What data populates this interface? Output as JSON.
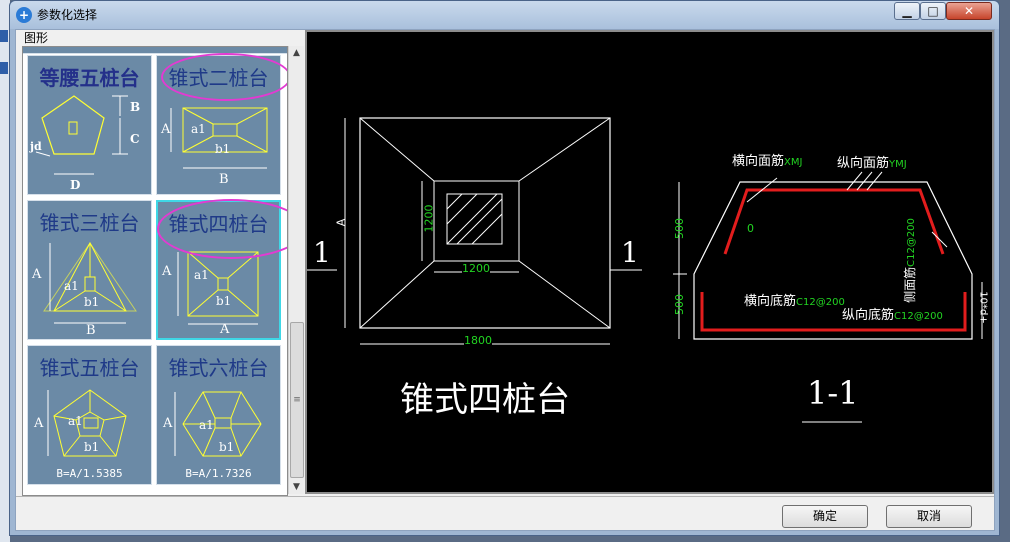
{
  "window": {
    "title": "参数化选择",
    "app_icon": "app-icon",
    "minimize": "▁",
    "maximize": "□",
    "close": "✕"
  },
  "group": {
    "label": "图形"
  },
  "tiles": [
    {
      "name": "等腰五桩台",
      "labels": {
        "b": "B",
        "c": "C",
        "d": "D",
        "jd": "jd"
      }
    },
    {
      "name": "锥式二桩台",
      "labels": {
        "a": "A",
        "a1": "a1",
        "b1": "b1",
        "b": "B"
      }
    },
    {
      "name": "锥式三桩台",
      "labels": {
        "a": "A",
        "a1": "a1",
        "b1": "b1",
        "b": "B"
      }
    },
    {
      "name": "锥式四桩台",
      "labels": {
        "a": "A",
        "a1": "a1",
        "b1": "b1",
        "a_bottom": "A"
      }
    },
    {
      "name": "锥式五桩台",
      "labels": {
        "a": "A",
        "a1": "a1",
        "b1": "b1"
      },
      "foot": "B=A/1.5385"
    },
    {
      "name": "锥式六桩台",
      "labels": {
        "a": "A",
        "a1": "a1",
        "b1": "b1"
      },
      "foot": "B=A/1.7326"
    }
  ],
  "preview": {
    "plan": {
      "dim_1200_v": "1200",
      "dim_1200_h": "1200",
      "dim_1800": "1800",
      "dim_a": "A",
      "cut_left": "1",
      "cut_right": "1",
      "caption": "锥式四桩台"
    },
    "section": {
      "heng_mian": "横向面筋",
      "heng_mian_code": "XMJ",
      "zong_mian": "纵向面筋",
      "zong_mian_code": "YMJ",
      "ce_mian": "侧面筋",
      "ce_mian_code": "C12@200",
      "heng_di": "横向底筋",
      "heng_di_code": "C12@200",
      "zong_di": "纵向底筋",
      "zong_di_code": "C12@200",
      "dim_500_top": "500",
      "dim_500_bot": "500",
      "dim_slope": "0",
      "dim_right": "10*d+",
      "caption": "1-1"
    }
  },
  "buttons": {
    "ok": "确定",
    "cancel": "取消"
  },
  "scroll": {
    "up": "▲",
    "down": "▼",
    "grip": "≡"
  },
  "colors": {
    "preview_bg": "#000000",
    "tile_bg": "#6b8aa6",
    "highlight": "#e23ad2",
    "rebar": "#e21d1d",
    "dim_text": "#22d422",
    "selected_border": "#3fd7e6"
  }
}
